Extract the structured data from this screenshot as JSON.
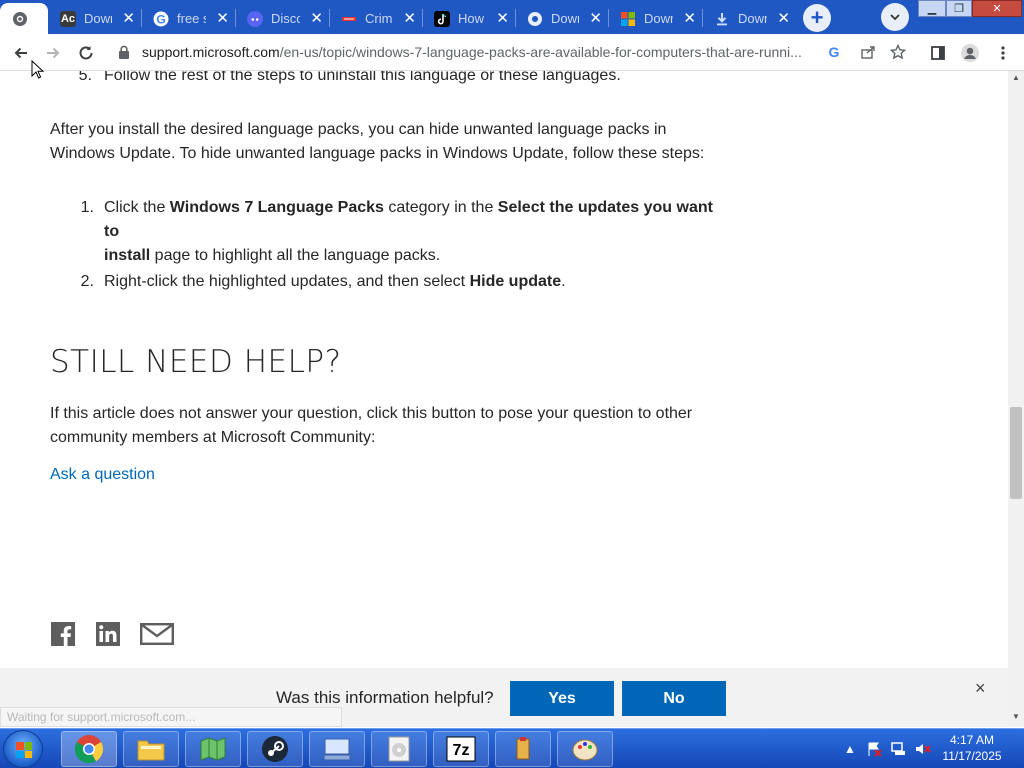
{
  "tabs": [
    {
      "title": "",
      "icon": "chrome-globe-icon",
      "active": true
    },
    {
      "title": "Down",
      "icon": "ac-icon"
    },
    {
      "title": "free s",
      "icon": "google-g-icon"
    },
    {
      "title": "Disco",
      "icon": "discord-icon"
    },
    {
      "title": "Crime",
      "icon": "news-icon"
    },
    {
      "title": "How",
      "icon": "tiktok-icon"
    },
    {
      "title": "Down",
      "icon": "globe-icon"
    },
    {
      "title": "Down",
      "icon": "microsoft-icon"
    },
    {
      "title": "Down",
      "icon": "download-icon"
    }
  ],
  "toolbar": {
    "url_host": "support.microsoft.com",
    "url_path": "/en-us/topic/windows-7-language-packs-are-available-for-computers-that-are-runni..."
  },
  "article": {
    "step5_num": "5.",
    "step5_text": "Follow the rest of the steps to uninstall this language or these languages.",
    "para_line1": "After you install the desired language packs, you can hide unwanted language packs in",
    "para_line2": "Windows Update. To hide unwanted language packs in Windows Update, follow these steps:",
    "item1_num": "1.",
    "item1_pre": "Click the ",
    "item1_b1": "Windows 7 Language Packs",
    "item1_mid": " category in the ",
    "item1_b2": "Select the updates you want to",
    "item1_b3": "install",
    "item1_post": " page to highlight all the language packs.",
    "item2_num": "2.",
    "item2_pre": "Right-click the highlighted updates, and then select ",
    "item2_b": "Hide update",
    "item2_post": ".",
    "help_heading": "STILL NEED HELP?",
    "help_line1": "If this article does not answer your question, click this button to pose your question to other",
    "help_line2": "community members at Microsoft Community:",
    "ask_link": "Ask a question"
  },
  "feedback": {
    "question": "Was this information helpful?",
    "yes": "Yes",
    "no": "No",
    "close": "×"
  },
  "status_text": "Waiting for support.microsoft.com...",
  "taskbar": {
    "time": "4:17 AM",
    "date": "11/17/2025"
  },
  "colors": {
    "link": "#0067b8",
    "button": "#0067b8",
    "tabstrip": "#1f57c3"
  }
}
